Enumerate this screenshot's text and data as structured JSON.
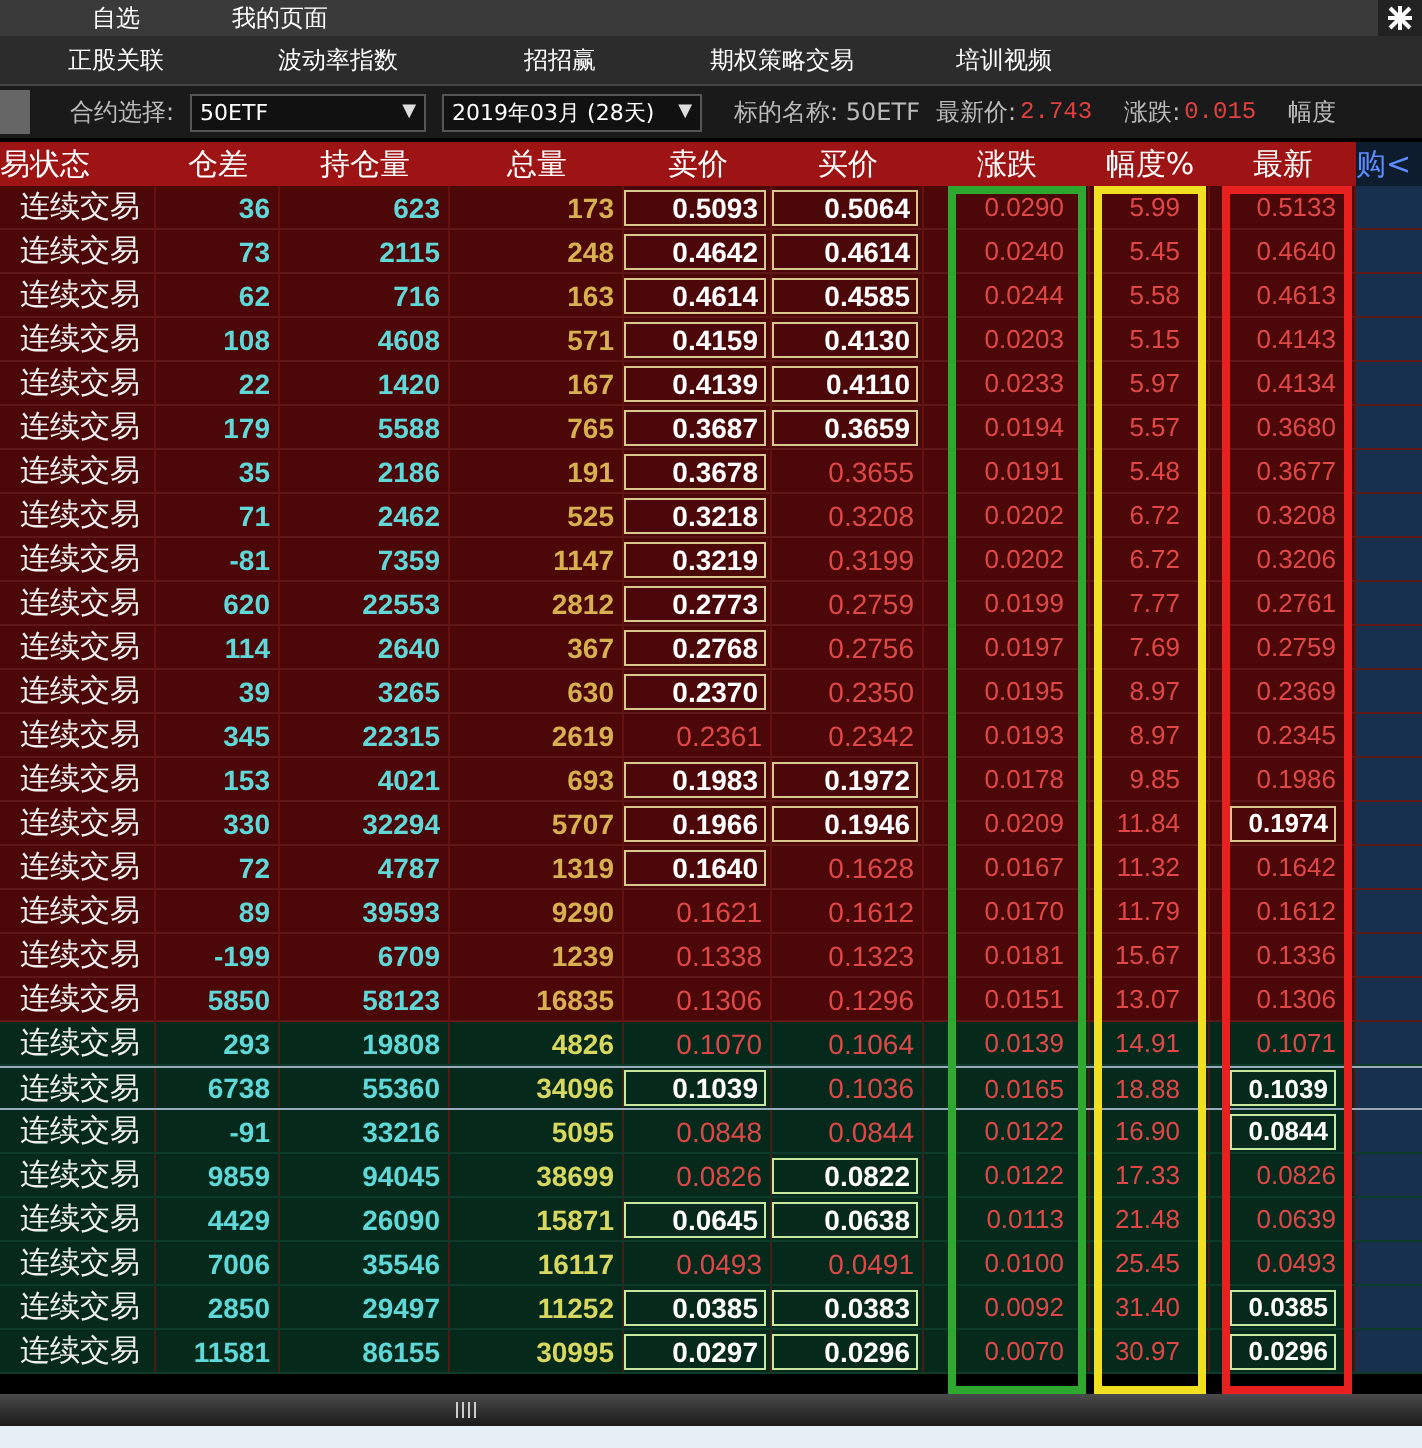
{
  "menu": [
    "自选",
    "我的页面"
  ],
  "tabs": [
    "正股关联",
    "波动率指数",
    "招招赢",
    "期权策略交易",
    "培训视频"
  ],
  "filter": {
    "contract_label": "合约选择:",
    "contract_value": "50ETF",
    "contract_caret": "▼",
    "month_value": "2019年03月 (28天)",
    "month_caret": "▼",
    "underlying": "标的名称: 50ETF",
    "price_label": "最新价:",
    "price": "2.743",
    "change_label": "涨跌:",
    "change": "0.015",
    "pct_label": "幅度"
  },
  "columns": [
    {
      "label": "易状态"
    },
    {
      "label": "仓差"
    },
    {
      "label": "持仓量"
    },
    {
      "label": "总量"
    },
    {
      "label": "卖价"
    },
    {
      "label": "买价"
    },
    {
      "label": "涨跌",
      "color": "#2ea82e"
    },
    {
      "label": "幅度%",
      "color": "#f0e020"
    },
    {
      "label": "最新",
      "color": "#e82020"
    },
    {
      "label": "购<"
    }
  ],
  "rows": [
    {
      "kind": "red",
      "selected": false,
      "status": "连续交易",
      "oi_change": "36",
      "open_interest": "623",
      "volume": "173",
      "ask": {
        "text": "0.5093",
        "boxed": true
      },
      "bid": {
        "text": "0.5064",
        "boxed": true
      },
      "change": "0.0290",
      "pct": "5.99",
      "last": {
        "text": "0.5133",
        "boxed": false
      }
    },
    {
      "kind": "red",
      "selected": false,
      "status": "连续交易",
      "oi_change": "73",
      "open_interest": "2115",
      "volume": "248",
      "ask": {
        "text": "0.4642",
        "boxed": true
      },
      "bid": {
        "text": "0.4614",
        "boxed": true
      },
      "change": "0.0240",
      "pct": "5.45",
      "last": {
        "text": "0.4640",
        "boxed": false
      }
    },
    {
      "kind": "red",
      "selected": false,
      "status": "连续交易",
      "oi_change": "62",
      "open_interest": "716",
      "volume": "163",
      "ask": {
        "text": "0.4614",
        "boxed": true
      },
      "bid": {
        "text": "0.4585",
        "boxed": true
      },
      "change": "0.0244",
      "pct": "5.58",
      "last": {
        "text": "0.4613",
        "boxed": false
      }
    },
    {
      "kind": "red",
      "selected": false,
      "status": "连续交易",
      "oi_change": "108",
      "open_interest": "4608",
      "volume": "571",
      "ask": {
        "text": "0.4159",
        "boxed": true
      },
      "bid": {
        "text": "0.4130",
        "boxed": true
      },
      "change": "0.0203",
      "pct": "5.15",
      "last": {
        "text": "0.4143",
        "boxed": false
      }
    },
    {
      "kind": "red",
      "selected": false,
      "status": "连续交易",
      "oi_change": "22",
      "open_interest": "1420",
      "volume": "167",
      "ask": {
        "text": "0.4139",
        "boxed": true
      },
      "bid": {
        "text": "0.4110",
        "boxed": true
      },
      "change": "0.0233",
      "pct": "5.97",
      "last": {
        "text": "0.4134",
        "boxed": false
      }
    },
    {
      "kind": "red",
      "selected": false,
      "status": "连续交易",
      "oi_change": "179",
      "open_interest": "5588",
      "volume": "765",
      "ask": {
        "text": "0.3687",
        "boxed": true
      },
      "bid": {
        "text": "0.3659",
        "boxed": true
      },
      "change": "0.0194",
      "pct": "5.57",
      "last": {
        "text": "0.3680",
        "boxed": false
      }
    },
    {
      "kind": "red",
      "selected": false,
      "status": "连续交易",
      "oi_change": "35",
      "open_interest": "2186",
      "volume": "191",
      "ask": {
        "text": "0.3678",
        "boxed": true
      },
      "bid": {
        "text": "0.3655",
        "boxed": false
      },
      "change": "0.0191",
      "pct": "5.48",
      "last": {
        "text": "0.3677",
        "boxed": false
      }
    },
    {
      "kind": "red",
      "selected": false,
      "status": "连续交易",
      "oi_change": "71",
      "open_interest": "2462",
      "volume": "525",
      "ask": {
        "text": "0.3218",
        "boxed": true
      },
      "bid": {
        "text": "0.3208",
        "boxed": false
      },
      "change": "0.0202",
      "pct": "6.72",
      "last": {
        "text": "0.3208",
        "boxed": false
      }
    },
    {
      "kind": "red",
      "selected": false,
      "status": "连续交易",
      "oi_change": "-81",
      "open_interest": "7359",
      "volume": "1147",
      "ask": {
        "text": "0.3219",
        "boxed": true
      },
      "bid": {
        "text": "0.3199",
        "boxed": false
      },
      "change": "0.0202",
      "pct": "6.72",
      "last": {
        "text": "0.3206",
        "boxed": false
      }
    },
    {
      "kind": "red",
      "selected": false,
      "status": "连续交易",
      "oi_change": "620",
      "open_interest": "22553",
      "volume": "2812",
      "ask": {
        "text": "0.2773",
        "boxed": true
      },
      "bid": {
        "text": "0.2759",
        "boxed": false
      },
      "change": "0.0199",
      "pct": "7.77",
      "last": {
        "text": "0.2761",
        "boxed": false
      }
    },
    {
      "kind": "red",
      "selected": false,
      "status": "连续交易",
      "oi_change": "114",
      "open_interest": "2640",
      "volume": "367",
      "ask": {
        "text": "0.2768",
        "boxed": true
      },
      "bid": {
        "text": "0.2756",
        "boxed": false
      },
      "change": "0.0197",
      "pct": "7.69",
      "last": {
        "text": "0.2759",
        "boxed": false
      }
    },
    {
      "kind": "red",
      "selected": false,
      "status": "连续交易",
      "oi_change": "39",
      "open_interest": "3265",
      "volume": "630",
      "ask": {
        "text": "0.2370",
        "boxed": true
      },
      "bid": {
        "text": "0.2350",
        "boxed": false
      },
      "change": "0.0195",
      "pct": "8.97",
      "last": {
        "text": "0.2369",
        "boxed": false
      }
    },
    {
      "kind": "red",
      "selected": false,
      "status": "连续交易",
      "oi_change": "345",
      "open_interest": "22315",
      "volume": "2619",
      "ask": {
        "text": "0.2361",
        "boxed": false
      },
      "bid": {
        "text": "0.2342",
        "boxed": false
      },
      "change": "0.0193",
      "pct": "8.97",
      "last": {
        "text": "0.2345",
        "boxed": false
      }
    },
    {
      "kind": "red",
      "selected": false,
      "status": "连续交易",
      "oi_change": "153",
      "open_interest": "4021",
      "volume": "693",
      "ask": {
        "text": "0.1983",
        "boxed": true
      },
      "bid": {
        "text": "0.1972",
        "boxed": true
      },
      "change": "0.0178",
      "pct": "9.85",
      "last": {
        "text": "0.1986",
        "boxed": false
      }
    },
    {
      "kind": "red",
      "selected": false,
      "status": "连续交易",
      "oi_change": "330",
      "open_interest": "32294",
      "volume": "5707",
      "ask": {
        "text": "0.1966",
        "boxed": true
      },
      "bid": {
        "text": "0.1946",
        "boxed": true
      },
      "change": "0.0209",
      "pct": "11.84",
      "last": {
        "text": "0.1974",
        "boxed": true
      }
    },
    {
      "kind": "red",
      "selected": false,
      "status": "连续交易",
      "oi_change": "72",
      "open_interest": "4787",
      "volume": "1319",
      "ask": {
        "text": "0.1640",
        "boxed": true
      },
      "bid": {
        "text": "0.1628",
        "boxed": false
      },
      "change": "0.0167",
      "pct": "11.32",
      "last": {
        "text": "0.1642",
        "boxed": false
      }
    },
    {
      "kind": "red",
      "selected": false,
      "status": "连续交易",
      "oi_change": "89",
      "open_interest": "39593",
      "volume": "9290",
      "ask": {
        "text": "0.1621",
        "boxed": false
      },
      "bid": {
        "text": "0.1612",
        "boxed": false
      },
      "change": "0.0170",
      "pct": "11.79",
      "last": {
        "text": "0.1612",
        "boxed": false
      }
    },
    {
      "kind": "red",
      "selected": false,
      "status": "连续交易",
      "oi_change": "-199",
      "open_interest": "6709",
      "volume": "1239",
      "ask": {
        "text": "0.1338",
        "boxed": false
      },
      "bid": {
        "text": "0.1323",
        "boxed": false
      },
      "change": "0.0181",
      "pct": "15.67",
      "last": {
        "text": "0.1336",
        "boxed": false
      }
    },
    {
      "kind": "red",
      "selected": false,
      "status": "连续交易",
      "oi_change": "5850",
      "open_interest": "58123",
      "volume": "16835",
      "ask": {
        "text": "0.1306",
        "boxed": false
      },
      "bid": {
        "text": "0.1296",
        "boxed": false
      },
      "change": "0.0151",
      "pct": "13.07",
      "last": {
        "text": "0.1306",
        "boxed": false
      }
    },
    {
      "kind": "green",
      "selected": false,
      "status": "连续交易",
      "oi_change": "293",
      "open_interest": "19808",
      "volume": "4826",
      "ask": {
        "text": "0.1070",
        "boxed": false
      },
      "bid": {
        "text": "0.1064",
        "boxed": false
      },
      "change": "0.0139",
      "pct": "14.91",
      "last": {
        "text": "0.1071",
        "boxed": false
      }
    },
    {
      "kind": "green",
      "selected": true,
      "status": "连续交易",
      "oi_change": "6738",
      "open_interest": "55360",
      "volume": "34096",
      "ask": {
        "text": "0.1039",
        "boxed": true
      },
      "bid": {
        "text": "0.1036",
        "boxed": false
      },
      "change": "0.0165",
      "pct": "18.88",
      "last": {
        "text": "0.1039",
        "boxed": true
      }
    },
    {
      "kind": "green",
      "selected": false,
      "status": "连续交易",
      "oi_change": "-91",
      "open_interest": "33216",
      "volume": "5095",
      "ask": {
        "text": "0.0848",
        "boxed": false
      },
      "bid": {
        "text": "0.0844",
        "boxed": false
      },
      "change": "0.0122",
      "pct": "16.90",
      "last": {
        "text": "0.0844",
        "boxed": true
      }
    },
    {
      "kind": "green",
      "selected": false,
      "status": "连续交易",
      "oi_change": "9859",
      "open_interest": "94045",
      "volume": "38699",
      "ask": {
        "text": "0.0826",
        "boxed": false
      },
      "bid": {
        "text": "0.0822",
        "boxed": true
      },
      "change": "0.0122",
      "pct": "17.33",
      "last": {
        "text": "0.0826",
        "boxed": false
      }
    },
    {
      "kind": "green",
      "selected": false,
      "status": "连续交易",
      "oi_change": "4429",
      "open_interest": "26090",
      "volume": "15871",
      "ask": {
        "text": "0.0645",
        "boxed": true
      },
      "bid": {
        "text": "0.0638",
        "boxed": true
      },
      "change": "0.0113",
      "pct": "21.48",
      "last": {
        "text": "0.0639",
        "boxed": false
      }
    },
    {
      "kind": "green",
      "selected": false,
      "status": "连续交易",
      "oi_change": "7006",
      "open_interest": "35546",
      "volume": "16117",
      "ask": {
        "text": "0.0493",
        "boxed": false
      },
      "bid": {
        "text": "0.0491",
        "boxed": false
      },
      "change": "0.0100",
      "pct": "25.45",
      "last": {
        "text": "0.0493",
        "boxed": false
      }
    },
    {
      "kind": "green",
      "selected": false,
      "status": "连续交易",
      "oi_change": "2850",
      "open_interest": "29497",
      "volume": "11252",
      "ask": {
        "text": "0.0385",
        "boxed": true
      },
      "bid": {
        "text": "0.0383",
        "boxed": true
      },
      "change": "0.0092",
      "pct": "31.40",
      "last": {
        "text": "0.0385",
        "boxed": true
      }
    },
    {
      "kind": "green",
      "selected": false,
      "status": "连续交易",
      "oi_change": "11581",
      "open_interest": "86155",
      "volume": "30995",
      "ask": {
        "text": "0.0297",
        "boxed": true
      },
      "bid": {
        "text": "0.0296",
        "boxed": true
      },
      "change": "0.0070",
      "pct": "30.97",
      "last": {
        "text": "0.0296",
        "boxed": true
      }
    }
  ]
}
